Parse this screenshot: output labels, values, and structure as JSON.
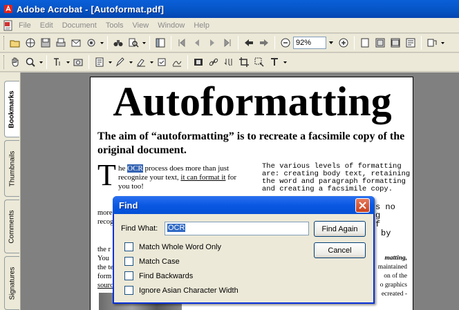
{
  "window": {
    "title": "Adobe Acrobat - [Autoformat.pdf]"
  },
  "menu": [
    "File",
    "Edit",
    "Document",
    "Tools",
    "View",
    "Window",
    "Help"
  ],
  "toolbar": {
    "zoom_value": "92%"
  },
  "nav_tabs": [
    "Bookmarks",
    "Thumbnails",
    "Comments",
    "Signatures"
  ],
  "document": {
    "heading": "Autoformatting",
    "subheading": "The aim of “autoformatting” is to recreate a facsimile copy of the original document.",
    "drop_cap": "T",
    "p1_a": "he ",
    "p1_highlight": "OCR",
    "p1_b": " process does more than just recognize your text, ",
    "p1_underline": "it can format it",
    "p1_c": " for you too!",
    "col2_text": "The various levels of formatting are: creating body text, retaining the word and paragraph formatting and creating a facsimile copy.",
    "frag_more": "more",
    "frag_recog": "recog",
    "frag_mono_1": "s no",
    "frag_mono_2": "g",
    "frag_mono_3": "f",
    "frag_mono_4": "by",
    "frag_left_1": "the r",
    "frag_left_2": "You",
    "frag_left_3": "the te",
    "frag_left_4": "form",
    "frag_left_5": "sourc",
    "frag_right_1": "matting,",
    "frag_right_2": "maintained",
    "frag_right_3": "on of the",
    "frag_right_4": "o graphics",
    "frag_right_5": "ecreated -"
  },
  "find_dialog": {
    "title": "Find",
    "find_what_label": "Find What:",
    "find_what_value": "OCR",
    "find_again_label": "Find Again",
    "cancel_label": "Cancel",
    "options": [
      {
        "label": "Match Whole Word Only",
        "checked": false
      },
      {
        "label": "Match Case",
        "checked": false
      },
      {
        "label": "Find Backwards",
        "checked": false
      },
      {
        "label": "Ignore Asian Character Width",
        "checked": false
      }
    ]
  }
}
